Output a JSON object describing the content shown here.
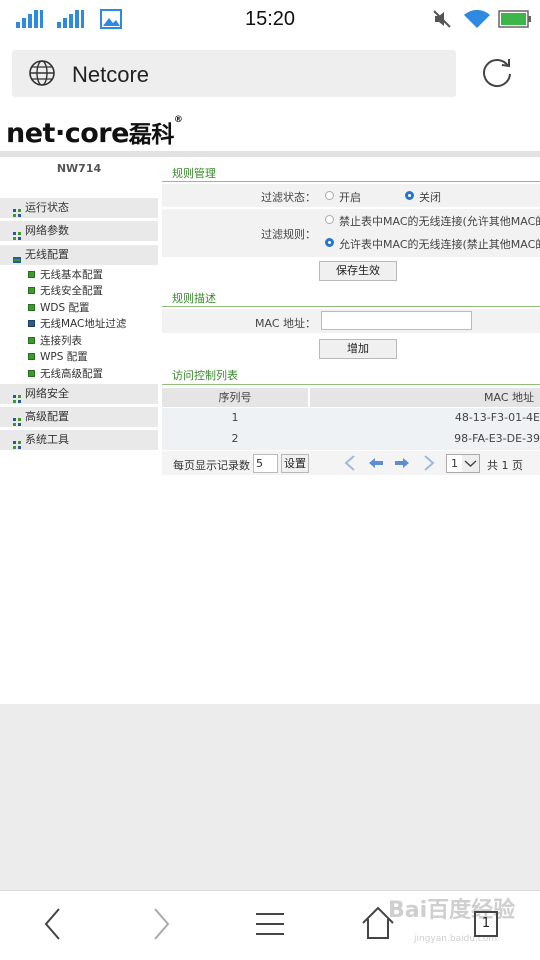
{
  "status_bar": {
    "time": "15:20",
    "icons": [
      "signal-icon",
      "signal-icon",
      "gallery-icon",
      "mute-icon",
      "wifi-icon",
      "battery-icon"
    ]
  },
  "browser": {
    "address": "Netcore"
  },
  "brand": {
    "logo_text": "net·core",
    "logo_cn": "磊科",
    "mark": "®"
  },
  "sidebar": {
    "model": "NW714",
    "items": [
      {
        "label": "运行状态",
        "color": "#3a9a2c"
      },
      {
        "label": "网络参数",
        "color": "#3a9a2c"
      },
      {
        "label": "无线配置",
        "color": "#3a9a2c",
        "expanded": true
      },
      {
        "label": "网络安全",
        "color": "#3a9a2c"
      },
      {
        "label": "高级配置",
        "color": "#3a9a2c"
      },
      {
        "label": "系统工具",
        "color": "#3a9a2c"
      }
    ],
    "sub_items": [
      {
        "label": "无线基本配置"
      },
      {
        "label": "无线安全配置"
      },
      {
        "label": "WDS 配置"
      },
      {
        "label": "无线MAC地址过滤",
        "selected": true
      },
      {
        "label": "连接列表"
      },
      {
        "label": "WPS 配置"
      },
      {
        "label": "无线高级配置"
      }
    ]
  },
  "main": {
    "rules": {
      "title": "规则管理",
      "filter_status_label": "过滤状态：",
      "status_on": "开启",
      "status_off": "关闭",
      "status_value": "关闭",
      "filter_rule_label": "过滤规则：",
      "rule_deny": "禁止表中MAC的无线连接(允许其他MAC的",
      "rule_allow": "允许表中MAC的无线连接(禁止其他MAC的",
      "rule_value": "allow",
      "save_label": "保存生效"
    },
    "desc": {
      "title": "规则描述",
      "mac_label": "MAC 地址：",
      "mac_value": "",
      "add_label": "增加"
    },
    "acl": {
      "title": "访问控制列表",
      "columns": [
        "序列号",
        "MAC 地址"
      ],
      "rows": [
        {
          "index": "1",
          "mac": "48-13-F3-01-4E"
        },
        {
          "index": "2",
          "mac": "98-FA-E3-DE-39"
        }
      ]
    },
    "pager": {
      "per_page_label": "每页显示记录数",
      "per_page_value": "5",
      "set_label": "设置",
      "page_value": "1",
      "total_label": "共 1 页"
    }
  },
  "watermark": {
    "text": "Bai百度经验",
    "sub": "jingyan.baidu.com"
  },
  "bottom_nav": {
    "tabs_count": "1",
    "accent": "#2677c9"
  }
}
